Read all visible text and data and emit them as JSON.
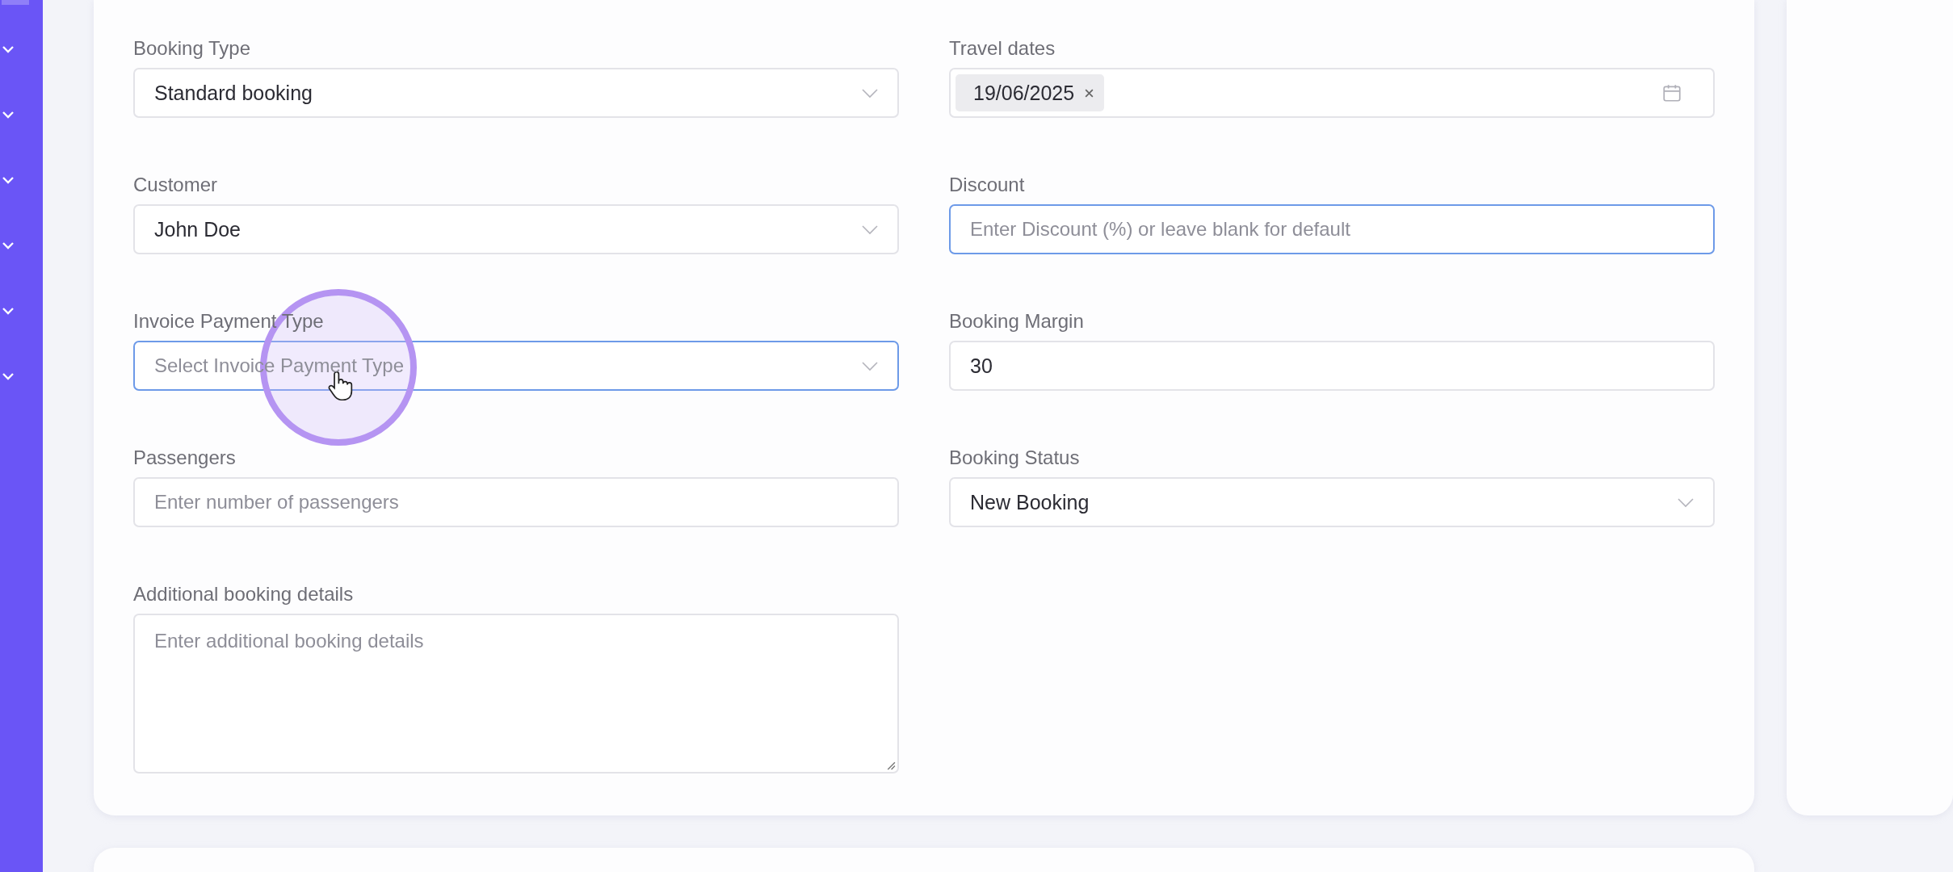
{
  "form": {
    "columns": [
      {
        "fields": [
          {
            "label": "Booking Type",
            "kind": "select",
            "value": "Standard booking",
            "focused": false
          },
          {
            "label": "Customer",
            "kind": "select",
            "value": "John Doe",
            "focused": false
          },
          {
            "label": "Invoice Payment Type",
            "kind": "select",
            "placeholder": "Select Invoice Payment Type",
            "focused": true
          },
          {
            "label": "Passengers",
            "kind": "input",
            "placeholder": "Enter number of passengers",
            "focused": false
          },
          {
            "label": "Additional booking details",
            "kind": "textarea",
            "placeholder": "Enter additional booking details",
            "focused": false
          }
        ]
      },
      {
        "fields": [
          {
            "label": "Travel dates",
            "kind": "date",
            "chips": [
              "19/06/2025"
            ],
            "focused": false
          },
          {
            "label": "Discount",
            "kind": "input",
            "placeholder": "Enter Discount (%) or leave blank for default",
            "focused": true
          },
          {
            "label": "Booking Margin",
            "kind": "input",
            "value": "30",
            "focused": false
          },
          {
            "label": "Booking Status",
            "kind": "select",
            "value": "New Booking",
            "focused": false
          }
        ]
      }
    ]
  }
}
